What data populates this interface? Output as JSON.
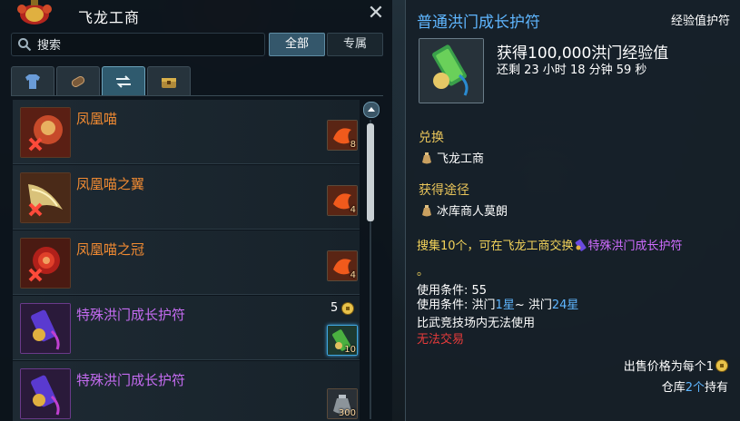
{
  "shop": {
    "title": "飞龙工商",
    "close_label": "✕",
    "search_placeholder": "搜索",
    "filter_all": "全部",
    "filter_exclusive": "专属",
    "tabs": [
      {
        "icon": "clothing-icon"
      },
      {
        "icon": "scroll-icon"
      },
      {
        "icon": "exchange-icon",
        "active": true
      },
      {
        "icon": "chest-icon"
      }
    ],
    "items": [
      {
        "name": "凤凰喵",
        "color": "#f08a32",
        "cost_qty": "8"
      },
      {
        "name": "凤凰喵之翼",
        "color": "#f08a32",
        "cost_qty": "4"
      },
      {
        "name": "凤凰喵之冠",
        "color": "#f08a32",
        "cost_qty": "4"
      },
      {
        "name": "特殊洪门成长护符",
        "color": "#c46bf0",
        "price": "5",
        "cost_qty": "10"
      },
      {
        "name": "特殊洪门成长护符",
        "color": "#c46bf0",
        "cost_qty": "300"
      }
    ]
  },
  "tooltip": {
    "title": "普通洪门成长护符",
    "type": "经验值护符",
    "effect": "获得100,000洪门经验值",
    "remaining": "还剩 23 小时 18 分钟 59 秒",
    "exchange_label": "兑换",
    "exchange_vendor": "飞龙工商",
    "source_label": "获得途径",
    "source_vendor": "冰库商人莫朗",
    "desc_prefix": "搜集10个，可在飞龙工商交换",
    "desc_item": "特殊洪门成长护符",
    "desc_suffix": "。",
    "req_level_label": "使用条件:",
    "req_level": "55",
    "req_rank_label": "使用条件:",
    "req_rank_a": "洪门",
    "req_rank_a_val": "1星",
    "req_rank_sep": "~",
    "req_rank_b": "洪门",
    "req_rank_b_val": "24星",
    "arena_note": "比武竞技场内无法使用",
    "no_trade": "无法交易",
    "sell_label": "出售价格为每个",
    "sell_value": "1",
    "storage_label": "仓库",
    "storage_value": "2个",
    "storage_suffix": "持有"
  },
  "colors": {
    "accent_blue": "#5fb6ff",
    "orange_name": "#f08a32",
    "purple_name": "#c46bf0",
    "section_gold": "#e9c55a",
    "warning_red": "#e83b3b"
  }
}
